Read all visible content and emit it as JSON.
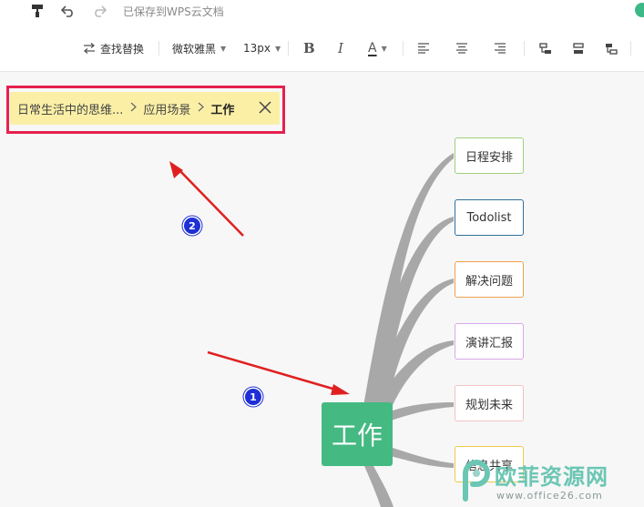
{
  "titlebar": {
    "format_painter_icon": "paint-roller-icon",
    "undo_icon": "undo-icon",
    "redo_icon": "redo-icon",
    "save_status": "已保存到WPS云文档"
  },
  "toolbar": {
    "find_replace_label": "查找替换",
    "font_family": "微软雅黑",
    "font_size": "13px",
    "bold_label": "B",
    "italic_label": "I",
    "font_color_label": "A"
  },
  "breadcrumb": {
    "items": [
      "日常生活中的思维...",
      "应用场景"
    ],
    "current": "工作",
    "separator": ">"
  },
  "mindmap": {
    "root": "工作",
    "root_color": "#45b982",
    "branch_color": "#a8a8a8",
    "children": [
      {
        "label": "日程安排",
        "border": "#9ed07a"
      },
      {
        "label": "Todolist",
        "border": "#2f6f9a"
      },
      {
        "label": "解决问题",
        "border": "#f0a050"
      },
      {
        "label": "演讲汇报",
        "border": "#d9a8e8"
      },
      {
        "label": "规划未来",
        "border": "#f3c2c2"
      },
      {
        "label": "信息共享",
        "border": "#f0c84a"
      }
    ]
  },
  "annotations": {
    "badge_1": "1",
    "badge_2": "2",
    "arrow_color": "#e02020",
    "highlight_color": "#e6214e"
  },
  "watermark": {
    "text": "欧菲资源网",
    "url": "www.office26.com"
  }
}
